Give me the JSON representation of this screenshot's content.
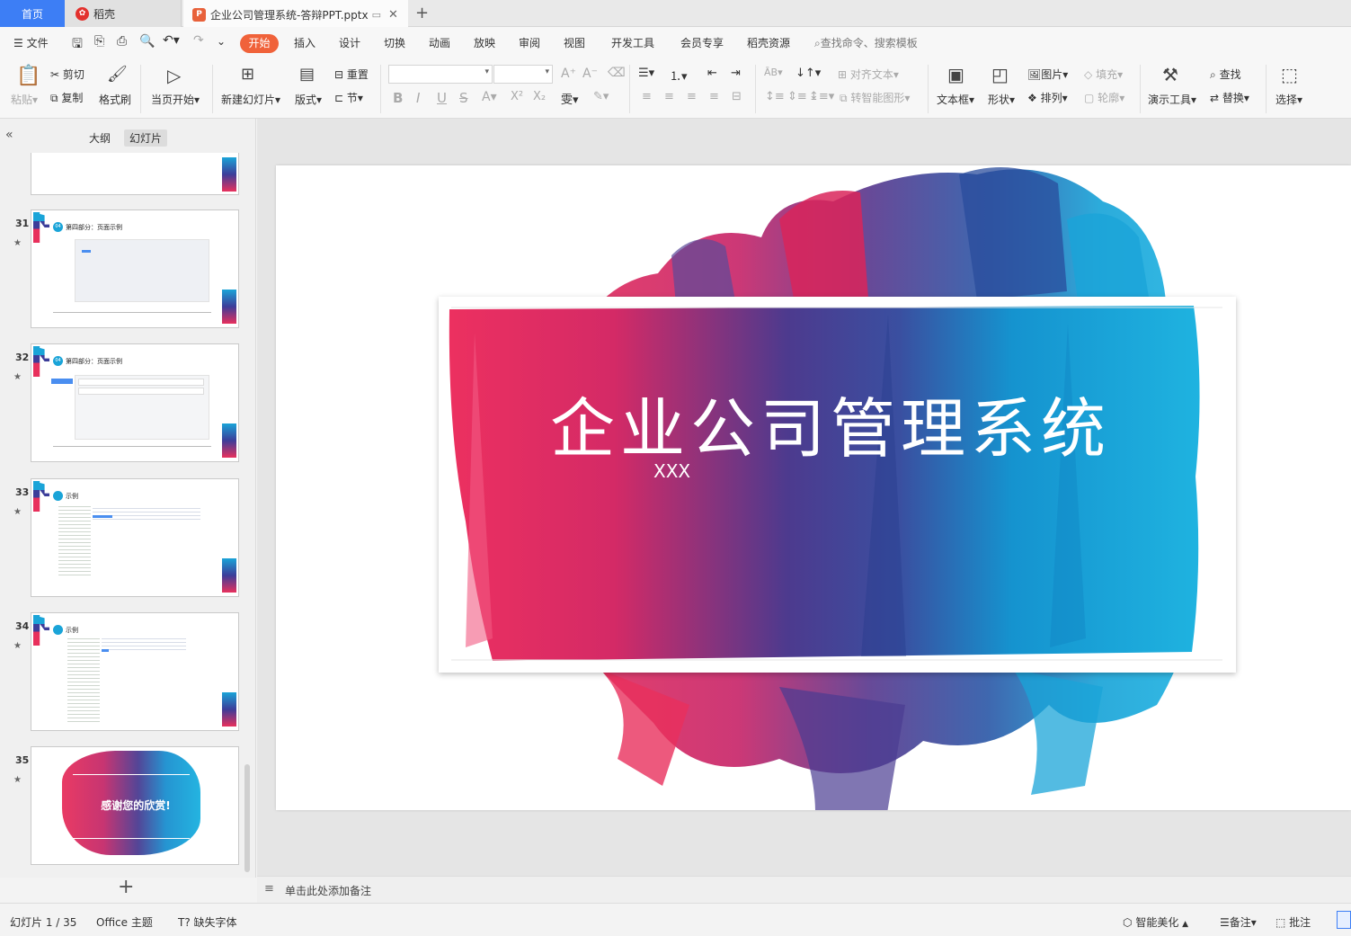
{
  "tabs": {
    "home": "首页",
    "daoke": "稻壳",
    "document": "企业公司管理系统-答辩PPT.pptx"
  },
  "menu": {
    "file": "文件",
    "items": [
      "开始",
      "插入",
      "设计",
      "切换",
      "动画",
      "放映",
      "审阅",
      "视图",
      "开发工具",
      "会员专享",
      "稻壳资源"
    ],
    "search_placeholder": "查找命令、搜索模板"
  },
  "toolbar": {
    "paste": "粘贴",
    "cut": "剪切",
    "copy": "复制",
    "format_painter": "格式刷",
    "play_from_current": "当页开始",
    "new_slide": "新建幻灯片",
    "layout": "版式",
    "reset": "重置",
    "section": "节",
    "align_text": "对齐文本",
    "smart_shape": "转智能图形",
    "text_box": "文本框",
    "shape": "形状",
    "picture": "图片",
    "arrange": "排列",
    "fill": "填充",
    "outline": "轮廓",
    "presentation_tools": "演示工具",
    "find": "查找",
    "replace": "替换",
    "select": "选择"
  },
  "left_pane": {
    "outline_tab": "大纲",
    "slides_tab": "幻灯片",
    "thumbnails": [
      {
        "num": "31",
        "title": "第四部分：页面示例"
      },
      {
        "num": "32",
        "title": "第四部分：页面示例"
      },
      {
        "num": "33",
        "title": "示例"
      },
      {
        "num": "34",
        "title": "示例"
      },
      {
        "num": "35",
        "title": "感谢您的欣赏!"
      }
    ],
    "badge": "04"
  },
  "slide": {
    "title": "企业公司管理系统",
    "subtitle": "XXX"
  },
  "notes_placeholder": "单击此处添加备注",
  "status": {
    "slide_counter": "幻灯片 1 / 35",
    "theme": "Office 主题",
    "missing_fonts": "缺失字体",
    "smart_beautify": "智能美化",
    "notes": "备注",
    "comments": "批注"
  },
  "colors": {
    "accent_orange": "#f0623a",
    "home_tab_blue": "#3d7ef5",
    "paint_pink": "#e8305c",
    "paint_purple": "#5a3a8f",
    "paint_blue": "#1aa4d8"
  }
}
